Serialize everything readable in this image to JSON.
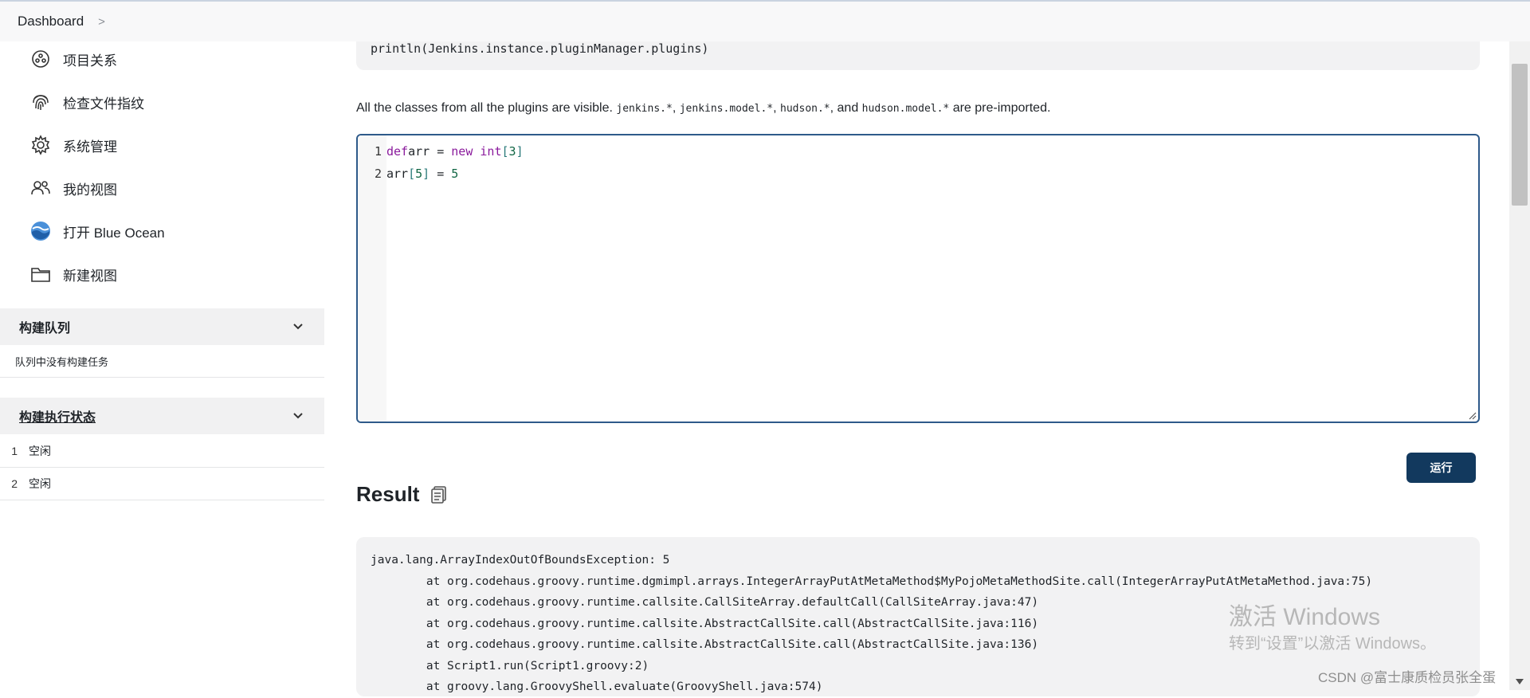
{
  "breadcrumb": {
    "dashboard": "Dashboard",
    "separator": ">"
  },
  "sidebar": {
    "items": [
      {
        "label": "项目关系",
        "icon": "network-icon"
      },
      {
        "label": "检查文件指纹",
        "icon": "fingerprint-icon"
      },
      {
        "label": "系统管理",
        "icon": "gear-icon"
      },
      {
        "label": "我的视图",
        "icon": "people-icon"
      },
      {
        "label": "打开 Blue Ocean",
        "icon": "blue-ocean-icon"
      },
      {
        "label": "新建视图",
        "icon": "folder-icon"
      }
    ],
    "build_queue": {
      "title": "构建队列",
      "empty": "队列中没有构建任务"
    },
    "executors": {
      "title": "构建执行状态",
      "rows": [
        {
          "num": "1",
          "state": "空闲"
        },
        {
          "num": "2",
          "state": "空闲"
        }
      ]
    }
  },
  "main": {
    "example_code": "println(Jenkins.instance.pluginManager.plugins)",
    "description": {
      "before": "All the classes from all the plugins are visible. ",
      "m1": "jenkins.*",
      "sep1": ", ",
      "m2": "jenkins.model.*",
      "sep2": ", ",
      "m3": "hudson.*",
      "sep3": ", and ",
      "m4": "hudson.model.*",
      "after": " are pre-imported."
    },
    "editor": {
      "lines": [
        {
          "num": "1",
          "tokens": [
            [
              "kw",
              "def"
            ],
            [
              "",
              "arr = "
            ],
            [
              "kw",
              "new"
            ],
            [
              "",
              ""
            ],
            [
              "kw",
              " int"
            ],
            [
              "br",
              "["
            ],
            [
              "num",
              "3"
            ],
            [
              "br",
              "]"
            ]
          ]
        },
        {
          "num": "2",
          "tokens": [
            [
              "",
              "arr"
            ],
            [
              "br",
              "["
            ],
            [
              "num",
              "5"
            ],
            [
              "br",
              "]"
            ],
            [
              "",
              " = "
            ],
            [
              "num",
              "5"
            ]
          ]
        }
      ]
    },
    "run_label": "运行",
    "result_title": "Result",
    "result_lines": [
      "java.lang.ArrayIndexOutOfBoundsException: 5",
      "\tat org.codehaus.groovy.runtime.dgmimpl.arrays.IntegerArrayPutAtMetaMethod$MyPojoMetaMethodSite.call(IntegerArrayPutAtMetaMethod.java:75)",
      "\tat org.codehaus.groovy.runtime.callsite.CallSiteArray.defaultCall(CallSiteArray.java:47)",
      "\tat org.codehaus.groovy.runtime.callsite.AbstractCallSite.call(AbstractCallSite.java:116)",
      "\tat org.codehaus.groovy.runtime.callsite.AbstractCallSite.call(AbstractCallSite.java:136)",
      "\tat Script1.run(Script1.groovy:2)",
      "\tat groovy.lang.GroovyShell.evaluate(GroovyShell.java:574)"
    ]
  },
  "overlay": {
    "activate_title": "激活 Windows",
    "activate_sub": "转到“设置”以激活 Windows。",
    "csdn": "CSDN @富士康质检员张全蛋"
  },
  "colors": {
    "accent": "#12395e",
    "editor_border": "#2e5a8a",
    "keyword": "#8a1a9c",
    "number": "#116644"
  }
}
